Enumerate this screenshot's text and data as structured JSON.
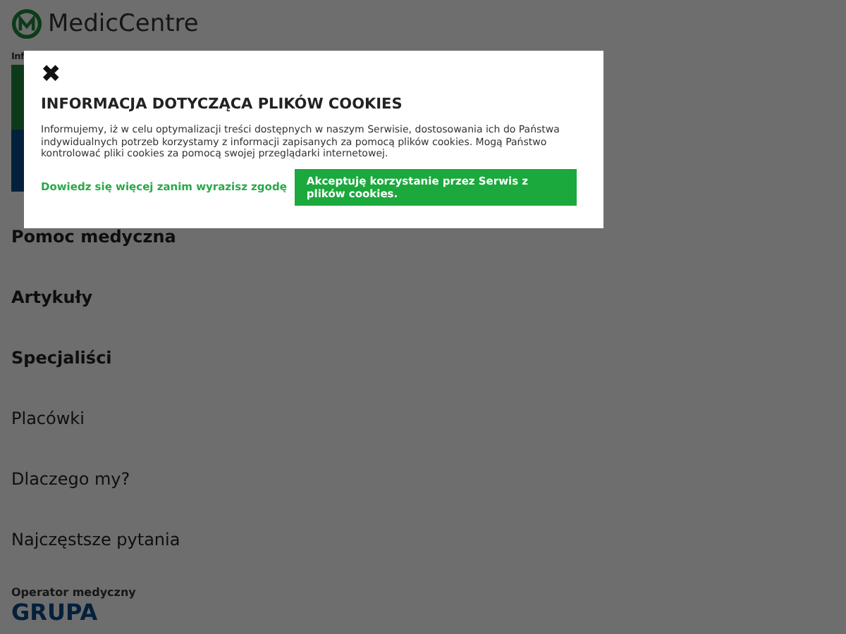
{
  "header": {
    "logo_text": "MedicCentre",
    "info_label": "Inf"
  },
  "menu": [
    {
      "label": "Pomoc medyczna",
      "bold": true
    },
    {
      "label": "Artykuły",
      "bold": true
    },
    {
      "label": "Specjaliści",
      "bold": true
    },
    {
      "label": "Placówki",
      "bold": false
    },
    {
      "label": "Dlaczego my?",
      "bold": false
    },
    {
      "label": "Najczęstsze pytania",
      "bold": false
    }
  ],
  "footer": {
    "operator_label": "Operator medyczny",
    "brand": "GRUPA"
  },
  "cookie_dialog": {
    "close": "✖",
    "title": "INFORMACJA DOTYCZĄCA PLIKÓW COOKIES",
    "body": "Informujemy, iż w celu optymalizacji treści dostępnych w naszym Serwisie, dostosowania ich do Państwa indywidualnych potrzeb korzystamy z informacji zapisanych za pomocą plików cookies. Mogą Państwo kontrolować pliki cookies za pomocą swojej przeglądarki internetowej.",
    "link": "Dowiedz się więcej zanim wyrazisz zgodę",
    "accept": "Akceptuję korzystanie przez Serwis z plików cookies."
  }
}
